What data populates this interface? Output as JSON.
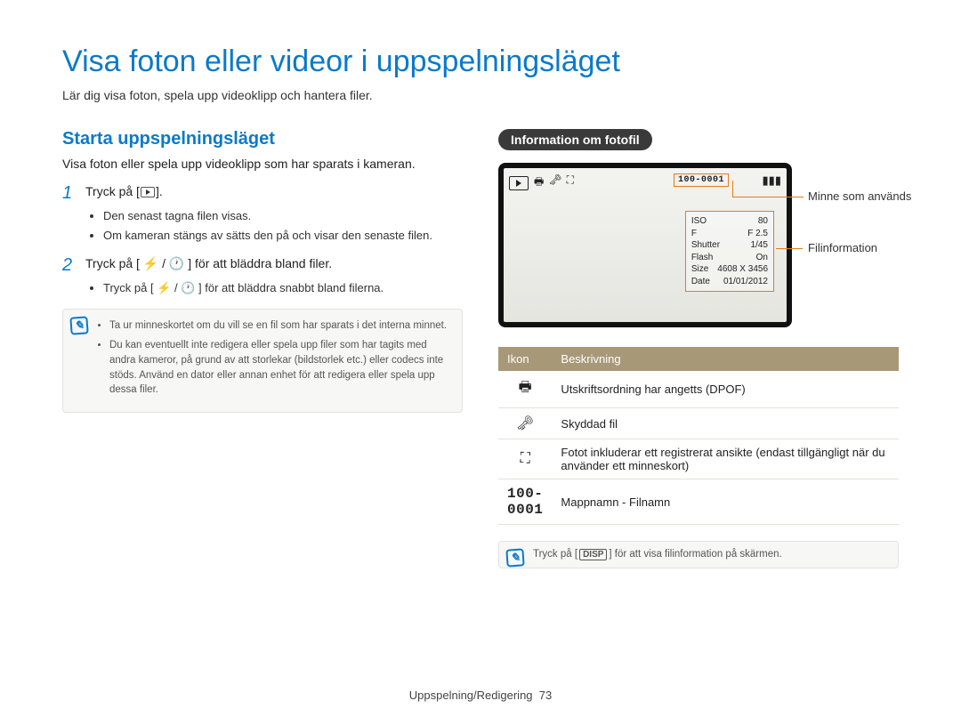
{
  "title": "Visa foton eller videor i uppspelningsläget",
  "intro": "Lär dig visa foton, spela upp videoklipp och hantera filer.",
  "section": {
    "heading": "Starta uppspelningsläget",
    "desc": "Visa foton eller spela upp videoklipp som har sparats i kameran."
  },
  "steps": [
    {
      "num": "1",
      "text_pre": "Tryck på [",
      "text_post": "].",
      "bullets": [
        "Den senast tagna filen visas.",
        "Om kameran stängs av sätts den på och visar den senaste filen."
      ]
    },
    {
      "num": "2",
      "text_full": "Tryck på [ ⚡ / 🕐 ] för att bläddra bland filer.",
      "bullets": [
        "Tryck på [ ⚡ / 🕐 ] för att bläddra snabbt bland filerna."
      ]
    }
  ],
  "notes": [
    "Ta ur minneskortet om du vill se en fil som har sparats i det interna minnet.",
    "Du kan eventuellt inte redigera eller spela upp filer som har tagits med andra kameror, på grund av att storlekar (bildstorlek etc.) eller codecs inte stöds. Använd en dator eller annan enhet för att redigera eller spela upp dessa filer."
  ],
  "info_badge": "Information om fotofil",
  "lcd": {
    "folder_id": "100-0001",
    "file_info": {
      "ISO_label": "ISO",
      "ISO_val": "80",
      "F_label": "F",
      "F_val": "F 2.5",
      "Shutter_label": "Shutter",
      "Shutter_val": "1/45",
      "Flash_label": "Flash",
      "Flash_val": "On",
      "Size_label": "Size",
      "Size_val": "4608 X 3456",
      "Date_label": "Date",
      "Date_val": "01/01/2012"
    }
  },
  "callouts": {
    "memory": "Minne som används",
    "fileinfo": "Filinformation"
  },
  "table": {
    "head_icon": "Ikon",
    "head_desc": "Beskrivning",
    "rows": [
      {
        "icon": "🖶",
        "desc": "Utskriftsordning har angetts (DPOF)"
      },
      {
        "icon": "🗝",
        "desc": "Skyddad fil"
      },
      {
        "icon": "⛶",
        "desc": "Fotot inkluderar ett registrerat ansikte (endast tillgängligt när du använder ett minneskort)"
      },
      {
        "icon_text": "100-0001",
        "desc": "Mappnamn - Filnamn"
      }
    ]
  },
  "tip_pre": "Tryck på [",
  "tip_key": "DISP",
  "tip_post": "] för att visa filinformation på skärmen.",
  "footer": {
    "section": "Uppspelning/Redigering",
    "page": "73"
  }
}
